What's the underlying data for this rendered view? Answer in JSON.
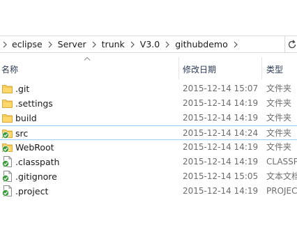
{
  "address_bar": {
    "crumbs": [
      "eclipse",
      "Server",
      "trunk",
      "V3.0",
      "githubdemo"
    ],
    "refresh_icon": "refresh-icon"
  },
  "columns": {
    "name": "名称",
    "date": "修改日期",
    "type": "类型",
    "sort_indicator": "caret-up-icon"
  },
  "files": [
    {
      "name": ".git",
      "date": "2015-12-14 15:07",
      "type": "文件夹",
      "icon": "folder-icon"
    },
    {
      "name": ".settings",
      "date": "2015-12-14 14:19",
      "type": "文件夹",
      "icon": "folder-icon"
    },
    {
      "name": "build",
      "date": "2015-12-14 14:19",
      "type": "文件夹",
      "icon": "folder-icon"
    },
    {
      "name": "src",
      "date": "2015-12-14 14:24",
      "type": "文件夹",
      "icon": "git-synced-folder-icon",
      "selected": true
    },
    {
      "name": "WebRoot",
      "date": "2015-12-14 14:19",
      "type": "文件夹",
      "icon": "git-synced-folder-icon"
    },
    {
      "name": ".classpath",
      "date": "2015-12-14 14:19",
      "type": "CLASSPATH",
      "icon": "git-synced-file-icon"
    },
    {
      "name": ".gitignore",
      "date": "2015-12-14 15:05",
      "type": "文本文档",
      "icon": "git-synced-file-icon"
    },
    {
      "name": ".project",
      "date": "2015-12-14 14:19",
      "type": "PROJECT",
      "icon": "git-synced-file-icon"
    }
  ],
  "colors": {
    "selection_border": "#99d1ff",
    "folder": "#ffd86b",
    "git_badge": "#3c9b3c"
  }
}
